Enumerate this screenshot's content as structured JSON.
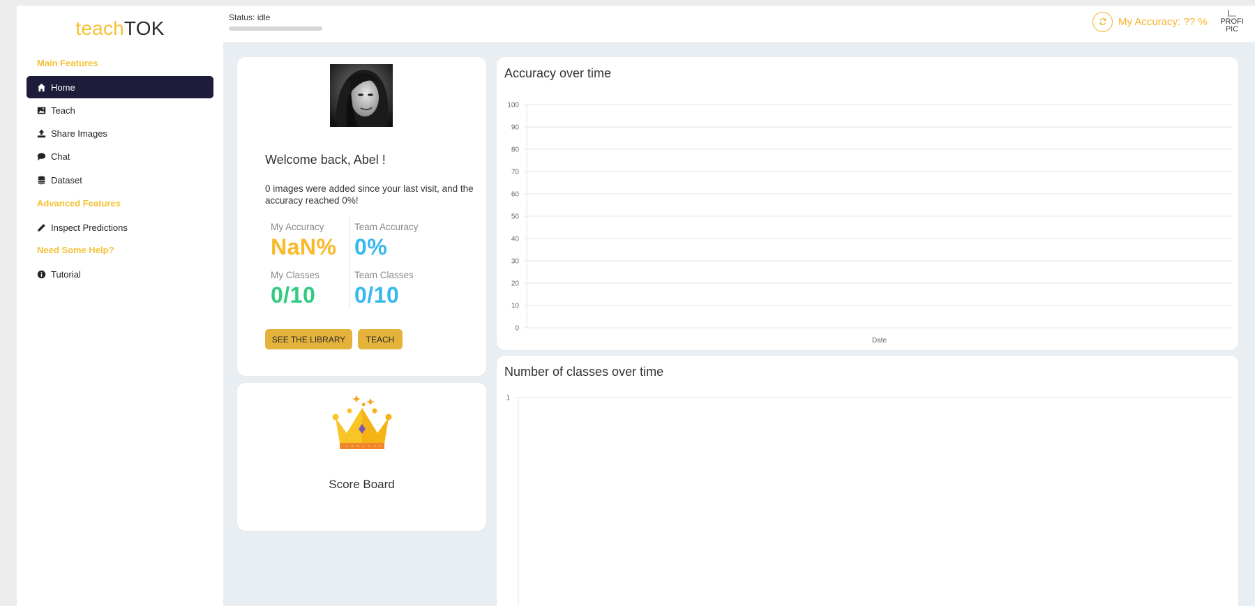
{
  "logo": {
    "part1": "teach",
    "part2": "TOK"
  },
  "sidebar": {
    "sections": [
      {
        "title": "Main Features"
      },
      {
        "title": "Advanced Features"
      },
      {
        "title": "Need Some Help?"
      }
    ],
    "items": [
      {
        "label": "Home",
        "icon": "home-icon",
        "active": true
      },
      {
        "label": "Teach",
        "icon": "image-icon"
      },
      {
        "label": "Share Images",
        "icon": "upload-icon"
      },
      {
        "label": "Chat",
        "icon": "chat-icon"
      },
      {
        "label": "Dataset",
        "icon": "database-icon"
      },
      {
        "label": "Inspect Predictions",
        "icon": "pencil-icon"
      },
      {
        "label": "Tutorial",
        "icon": "info-icon"
      }
    ]
  },
  "header": {
    "status": "Status: idle",
    "accuracy_label": "My Accuracy: ?? %",
    "profile_alt": "PROFI PIC"
  },
  "welcome": {
    "title": "Welcome back, Abel !",
    "message": "0 images were added since your last visit, and the accuracy reached 0%!",
    "stats": {
      "my_accuracy_label": "My Accuracy",
      "my_accuracy_value": "NaN%",
      "team_accuracy_label": "Team Accuracy",
      "team_accuracy_value": "0%",
      "my_classes_label": "My Classes",
      "my_classes_value": "0/10",
      "team_classes_label": "Team Classes",
      "team_classes_value": "0/10"
    },
    "buttons": {
      "library": "SEE THE LIBRARY",
      "teach": "TEACH"
    }
  },
  "scoreboard": {
    "title": "Score Board"
  },
  "colors": {
    "accent": "#f5c236",
    "button": "#e5b33c",
    "nav_active": "#1d1c3a",
    "stat_orange": "#f9b928",
    "stat_blue": "#36b8ee",
    "stat_green": "#2fcb7f"
  },
  "chart_data": [
    {
      "type": "line",
      "title": "Accuracy over time",
      "xlabel": "Date",
      "ylabel": "",
      "ylim": [
        0,
        100
      ],
      "yticks": [
        100,
        90,
        80,
        70,
        60,
        50,
        40,
        30,
        20,
        10,
        0
      ],
      "grid": true,
      "series": []
    },
    {
      "type": "line",
      "title": "Number of classes over time",
      "xlabel": "",
      "ylabel": "",
      "yticks": [
        1
      ],
      "grid": true,
      "series": []
    }
  ]
}
